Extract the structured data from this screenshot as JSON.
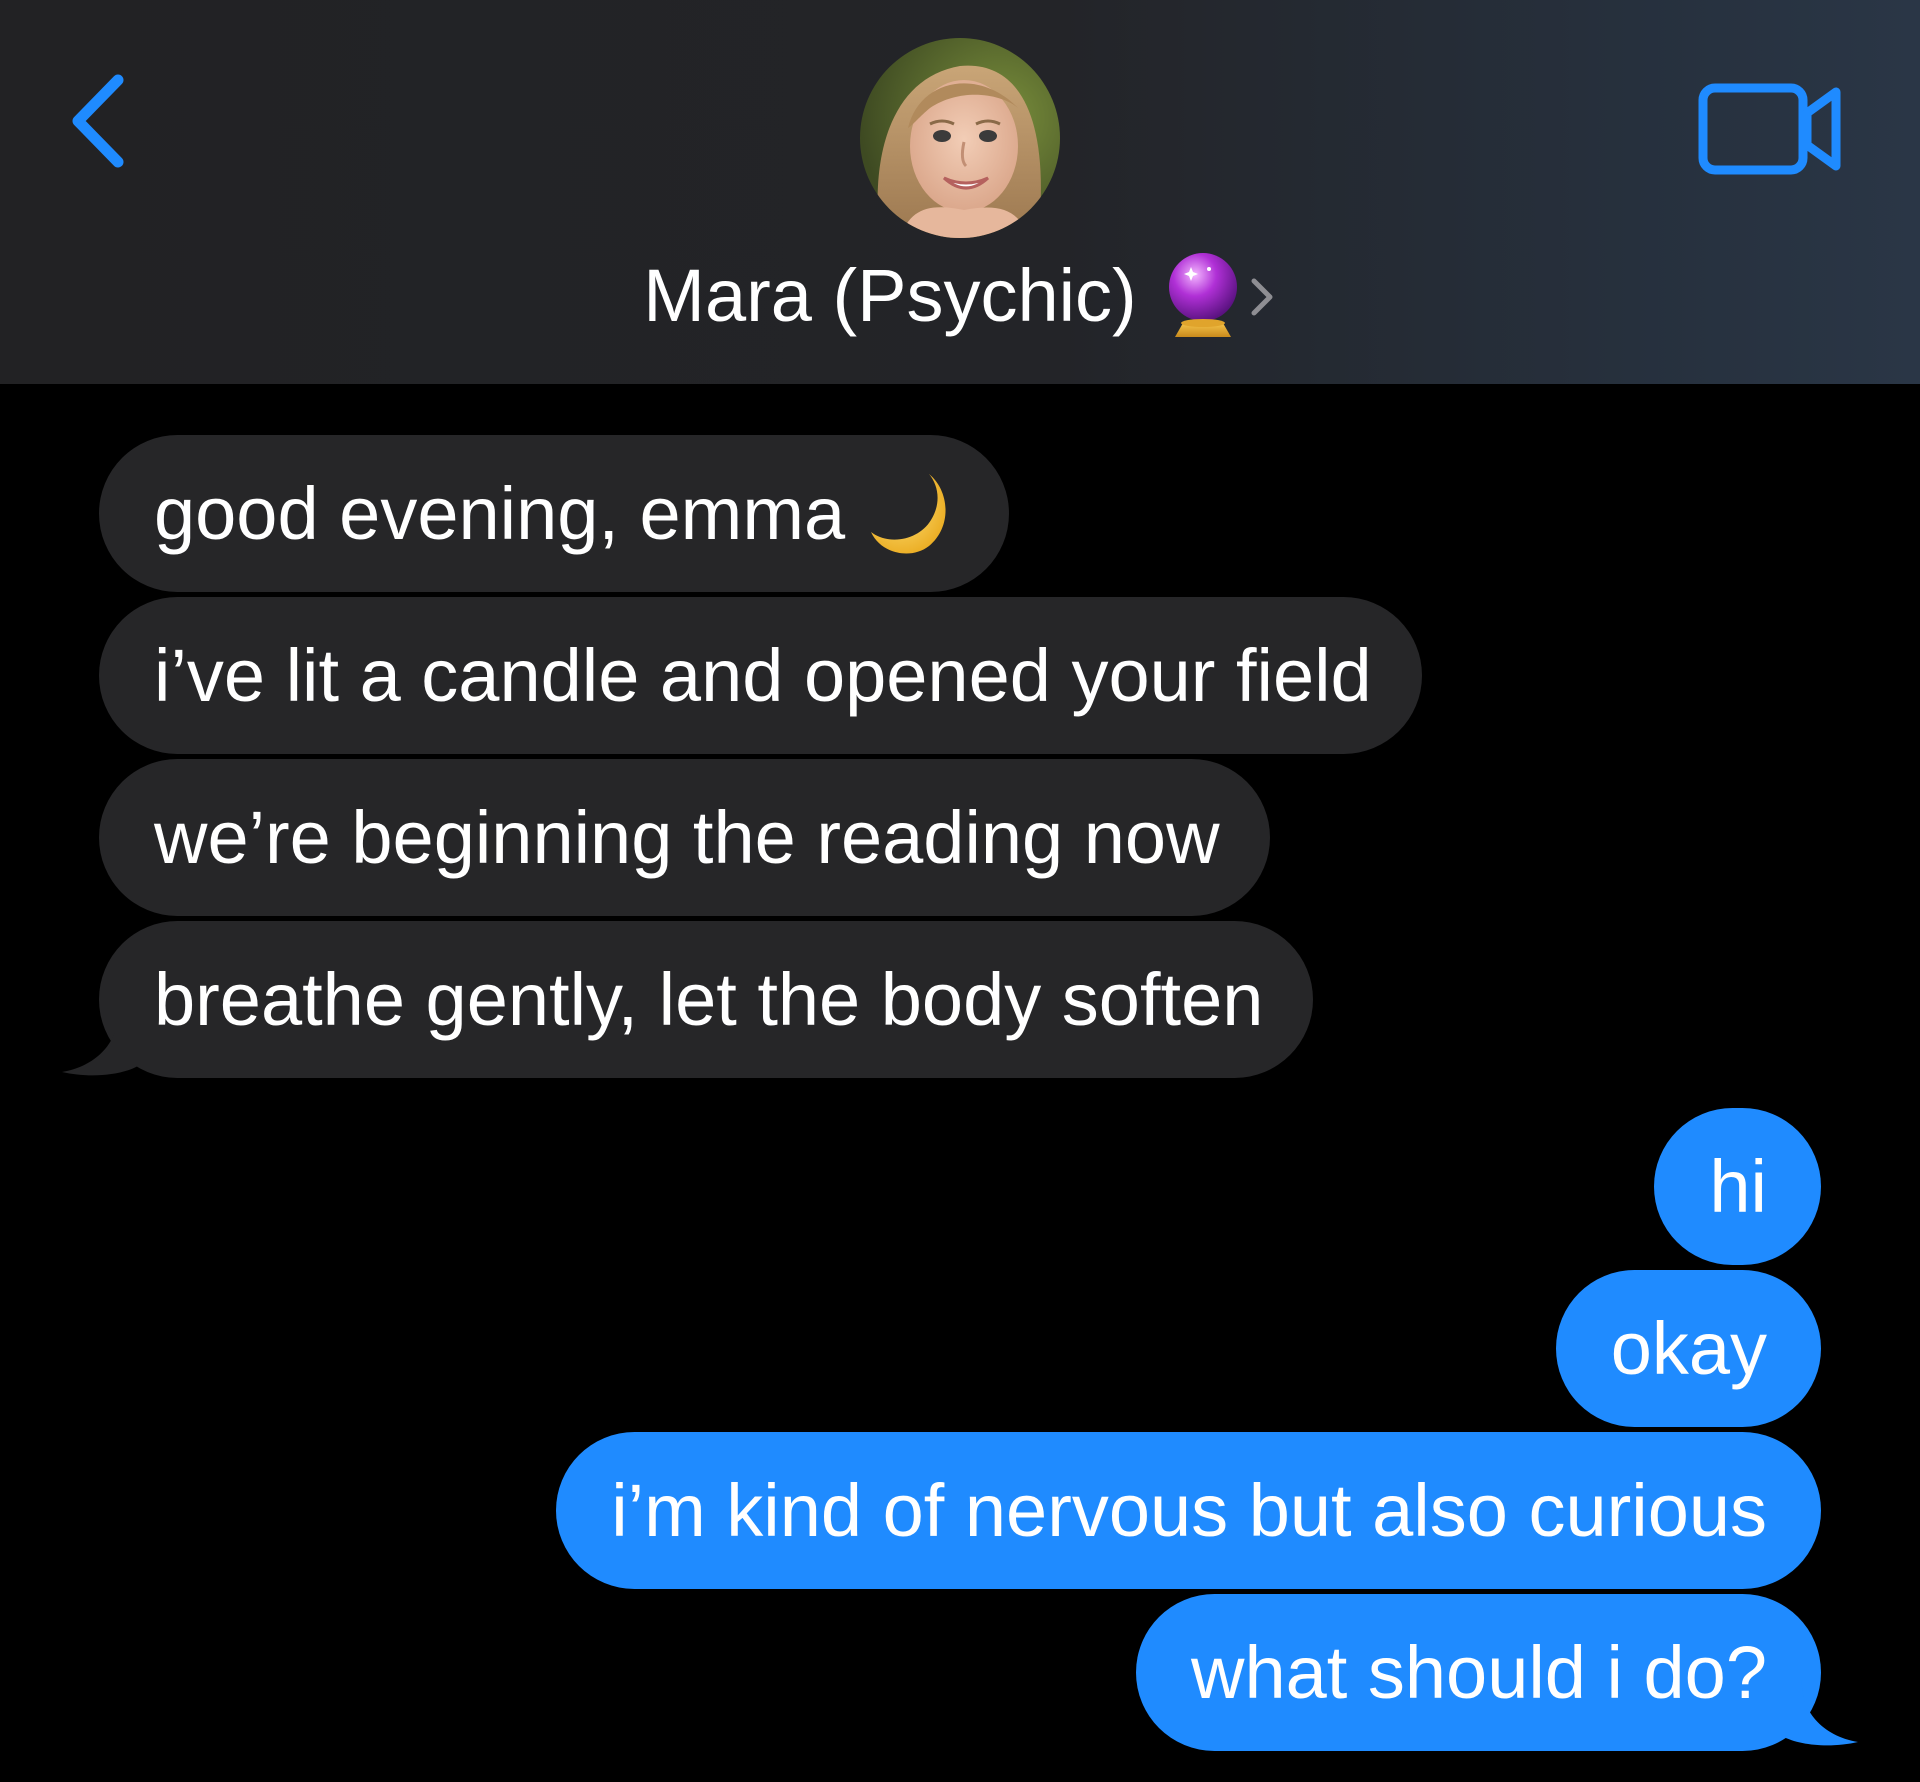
{
  "header": {
    "contact_name": "Mara (Psychic)",
    "icons": {
      "back": "chevron-left-icon",
      "video": "video-camera-icon",
      "contact_emoji": "crystal-ball-icon",
      "contact_disclosure": "chevron-right-icon"
    },
    "colors": {
      "accent": "#1f8bff",
      "background": "#232326"
    }
  },
  "messages": [
    {
      "direction": "incoming",
      "text": "good evening, emma",
      "emoji": "moon-icon"
    },
    {
      "direction": "incoming",
      "text": "i’ve lit a candle and opened your field"
    },
    {
      "direction": "incoming",
      "text": "we’re beginning the reading now"
    },
    {
      "direction": "incoming",
      "text": "breathe gently, let the body soften"
    },
    {
      "direction": "outgoing",
      "text": "hi"
    },
    {
      "direction": "outgoing",
      "text": "okay"
    },
    {
      "direction": "outgoing",
      "text": "i’m kind of nervous but also curious"
    },
    {
      "direction": "outgoing",
      "text": "what should i do?"
    }
  ],
  "colors": {
    "incoming_bubble": "#262628",
    "outgoing_bubble": "#1f8bff",
    "text": "#ffffff"
  }
}
